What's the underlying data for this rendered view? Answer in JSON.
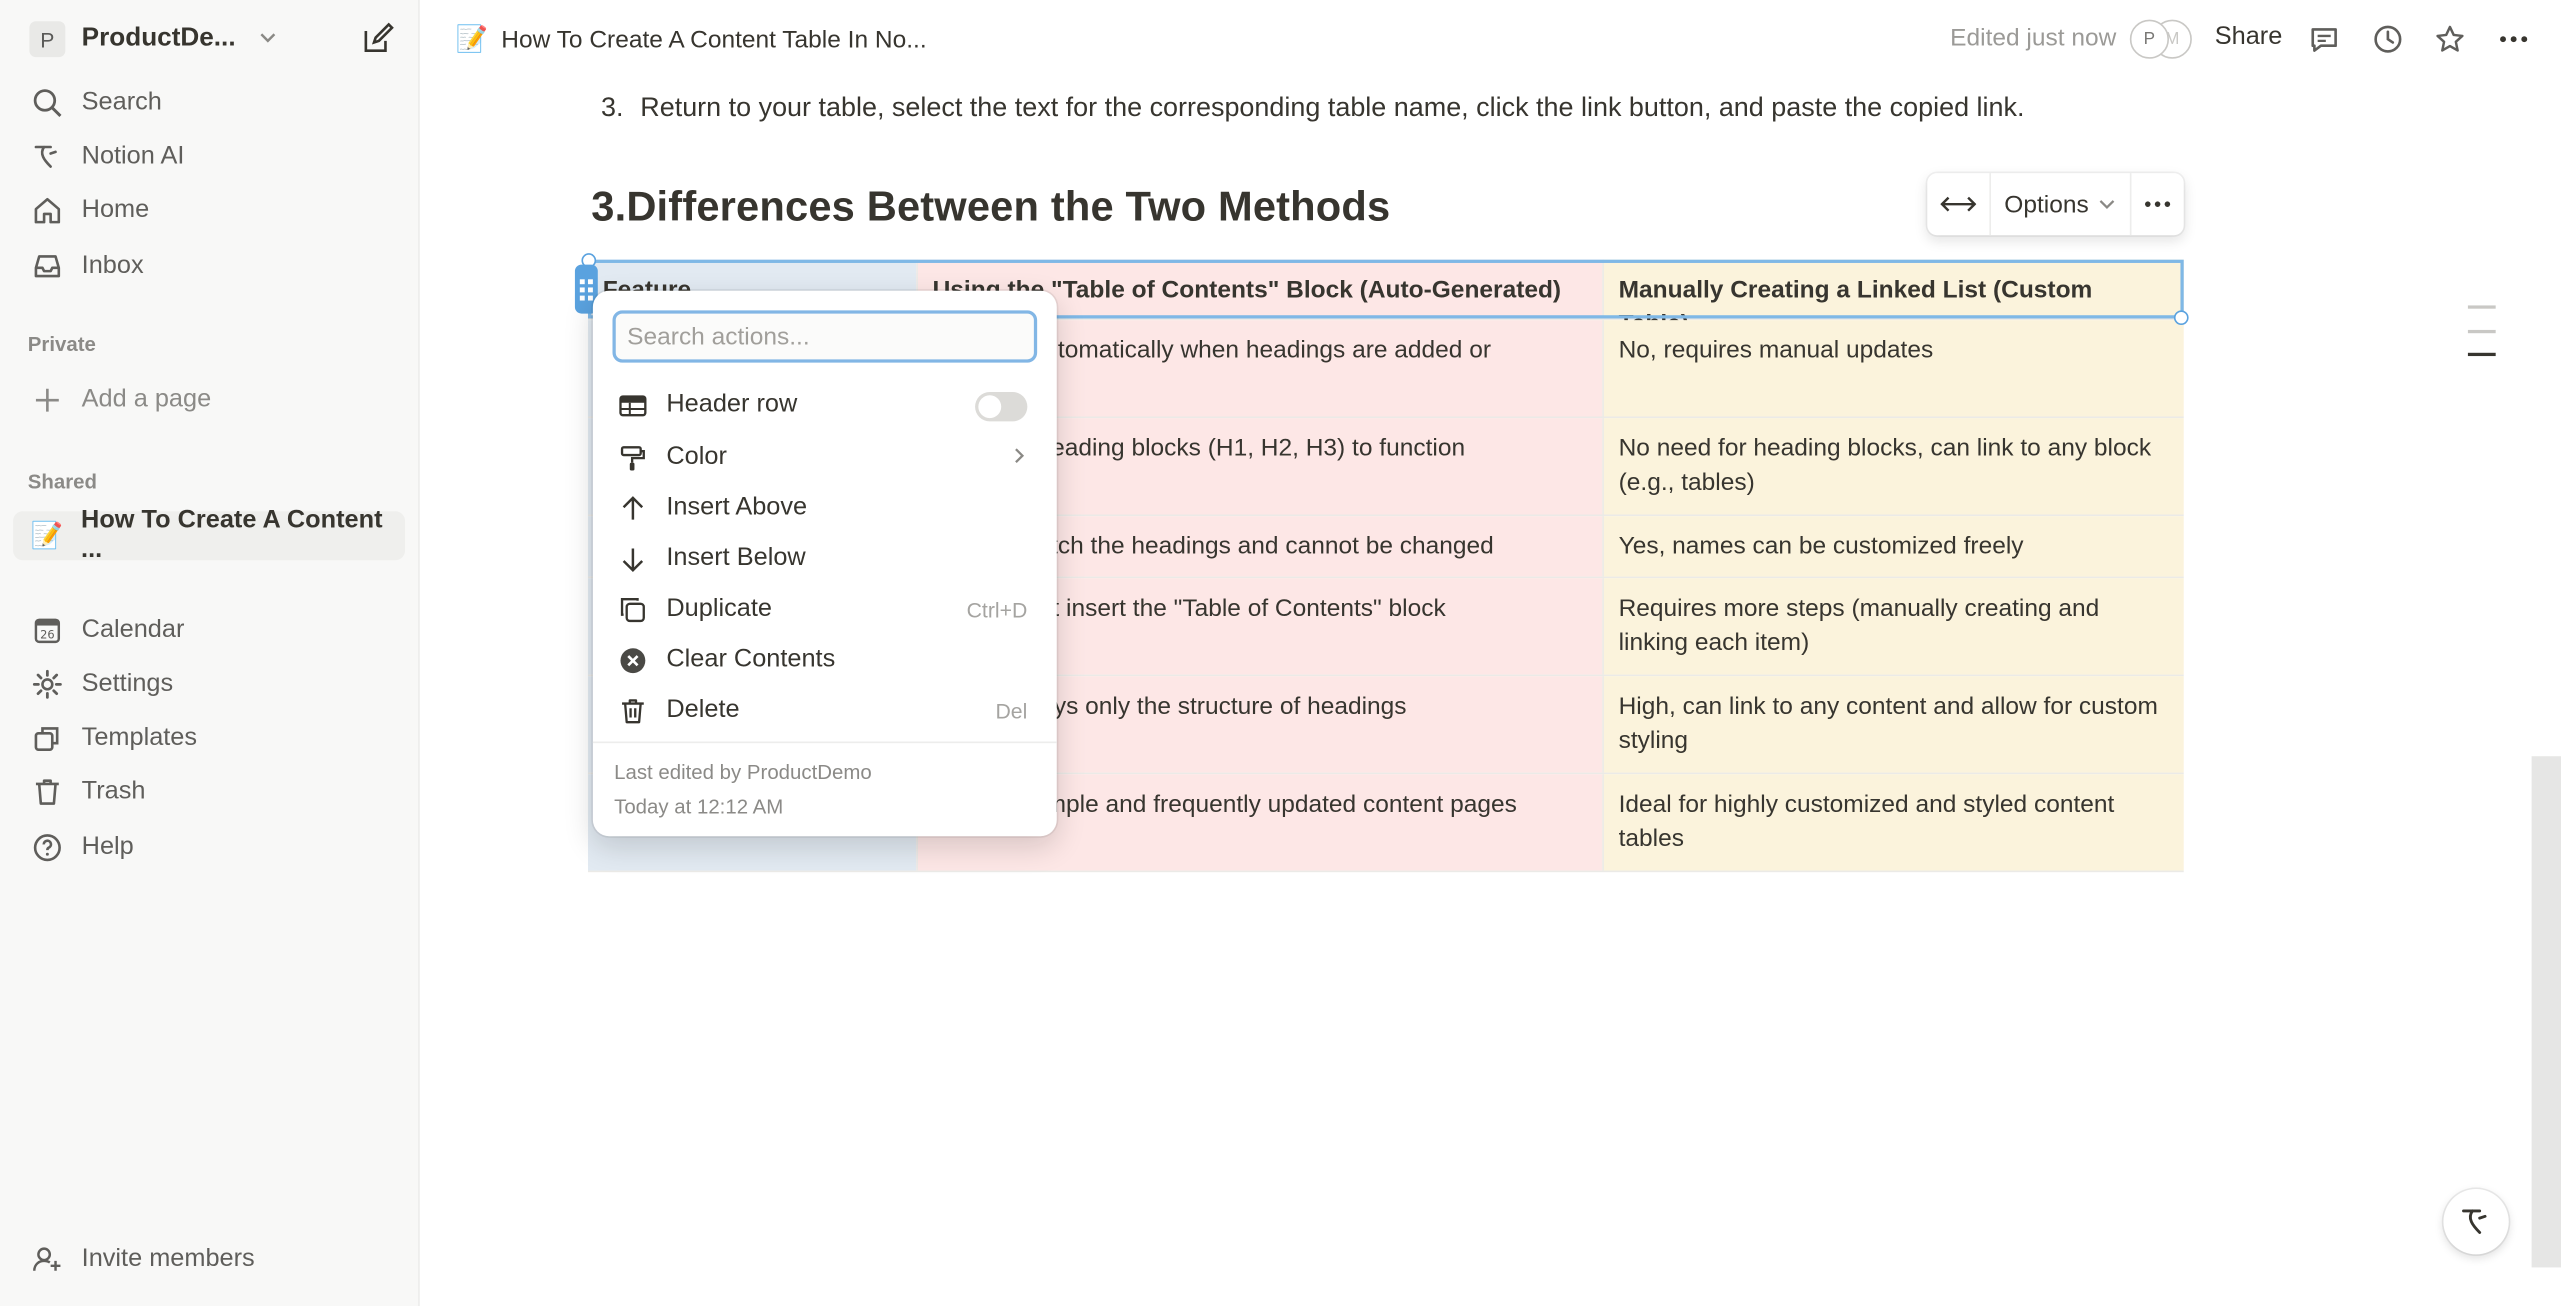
{
  "workspace": {
    "avatar_letter": "P",
    "name": "ProductDe..."
  },
  "sidebar": {
    "nav": [
      {
        "label": "Search",
        "icon": "search-icon"
      },
      {
        "label": "Notion AI",
        "icon": "notion-ai-icon"
      },
      {
        "label": "Home",
        "icon": "home-icon"
      },
      {
        "label": "Inbox",
        "icon": "inbox-icon"
      }
    ],
    "private_label": "Private",
    "add_page": "Add a page",
    "shared_label": "Shared",
    "shared_page": {
      "emoji": "📝",
      "label": "How To Create A Content ..."
    },
    "bottom_nav": [
      {
        "label": "Calendar",
        "icon": "calendar-icon",
        "badge": "26"
      },
      {
        "label": "Settings",
        "icon": "gear-icon"
      },
      {
        "label": "Templates",
        "icon": "templates-icon"
      },
      {
        "label": "Trash",
        "icon": "trash-icon"
      },
      {
        "label": "Help",
        "icon": "help-icon"
      }
    ],
    "invite": "Invite members"
  },
  "topbar": {
    "emoji": "📝",
    "breadcrumb": "How To Create A Content Table In No...",
    "edited": "Edited just now",
    "avatars": [
      "P",
      "M"
    ],
    "share": "Share"
  },
  "content": {
    "step_number": "3.",
    "step_text": "Return to your table, select the text for the corresponding table name, click the link button, and paste the copied link.",
    "heading": "3.Differences Between the Two Methods"
  },
  "table_toolbar": {
    "options_label": "Options"
  },
  "table": {
    "headers": [
      "Feature",
      "Using the \"Table of Contents\" Block (Auto-Generated)",
      "Manually Creating a Linked List (Custom Table)"
    ],
    "rows": [
      [
        "",
        "Updates automatically when headings are added or",
        "No, requires manual updates"
      ],
      [
        "",
        "Requires heading blocks (H1, H2, H3) to function",
        "No need for heading blocks, can link to any block (e.g., tables)"
      ],
      [
        "",
        "Names match the headings and cannot be changed",
        "Yes, names can be customized freely"
      ],
      [
        "",
        "Simple, just insert the \"Table of Contents\" block",
        "Requires more steps (manually creating and linking each item)"
      ],
      [
        "",
        "Low, displays only the structure of headings",
        "High, can link to any content and allow for custom styling"
      ],
      [
        "",
        "Ideal for simple and frequently updated content pages",
        "Ideal for highly customized and styled content tables"
      ]
    ]
  },
  "context_menu": {
    "search_placeholder": "Search actions...",
    "items": [
      {
        "label": "Header row",
        "icon": "table-icon"
      },
      {
        "label": "Color",
        "icon": "paint-roller-icon"
      },
      {
        "label": "Insert Above",
        "icon": "arrow-up-icon"
      },
      {
        "label": "Insert Below",
        "icon": "arrow-down-icon"
      },
      {
        "label": "Duplicate",
        "icon": "duplicate-icon",
        "shortcut": "Ctrl+D"
      },
      {
        "label": "Clear Contents",
        "icon": "clear-icon"
      },
      {
        "label": "Delete",
        "icon": "trash-icon",
        "shortcut": "Del"
      }
    ],
    "footer_line1": "Last edited by ProductDemo",
    "footer_line2": "Today at 12:12 AM"
  },
  "colors": {
    "feature_col": "#e2eaf2",
    "toc_col": "#fde7e6",
    "manual_col": "#fbf3dc",
    "selection": "#5aa2df"
  }
}
